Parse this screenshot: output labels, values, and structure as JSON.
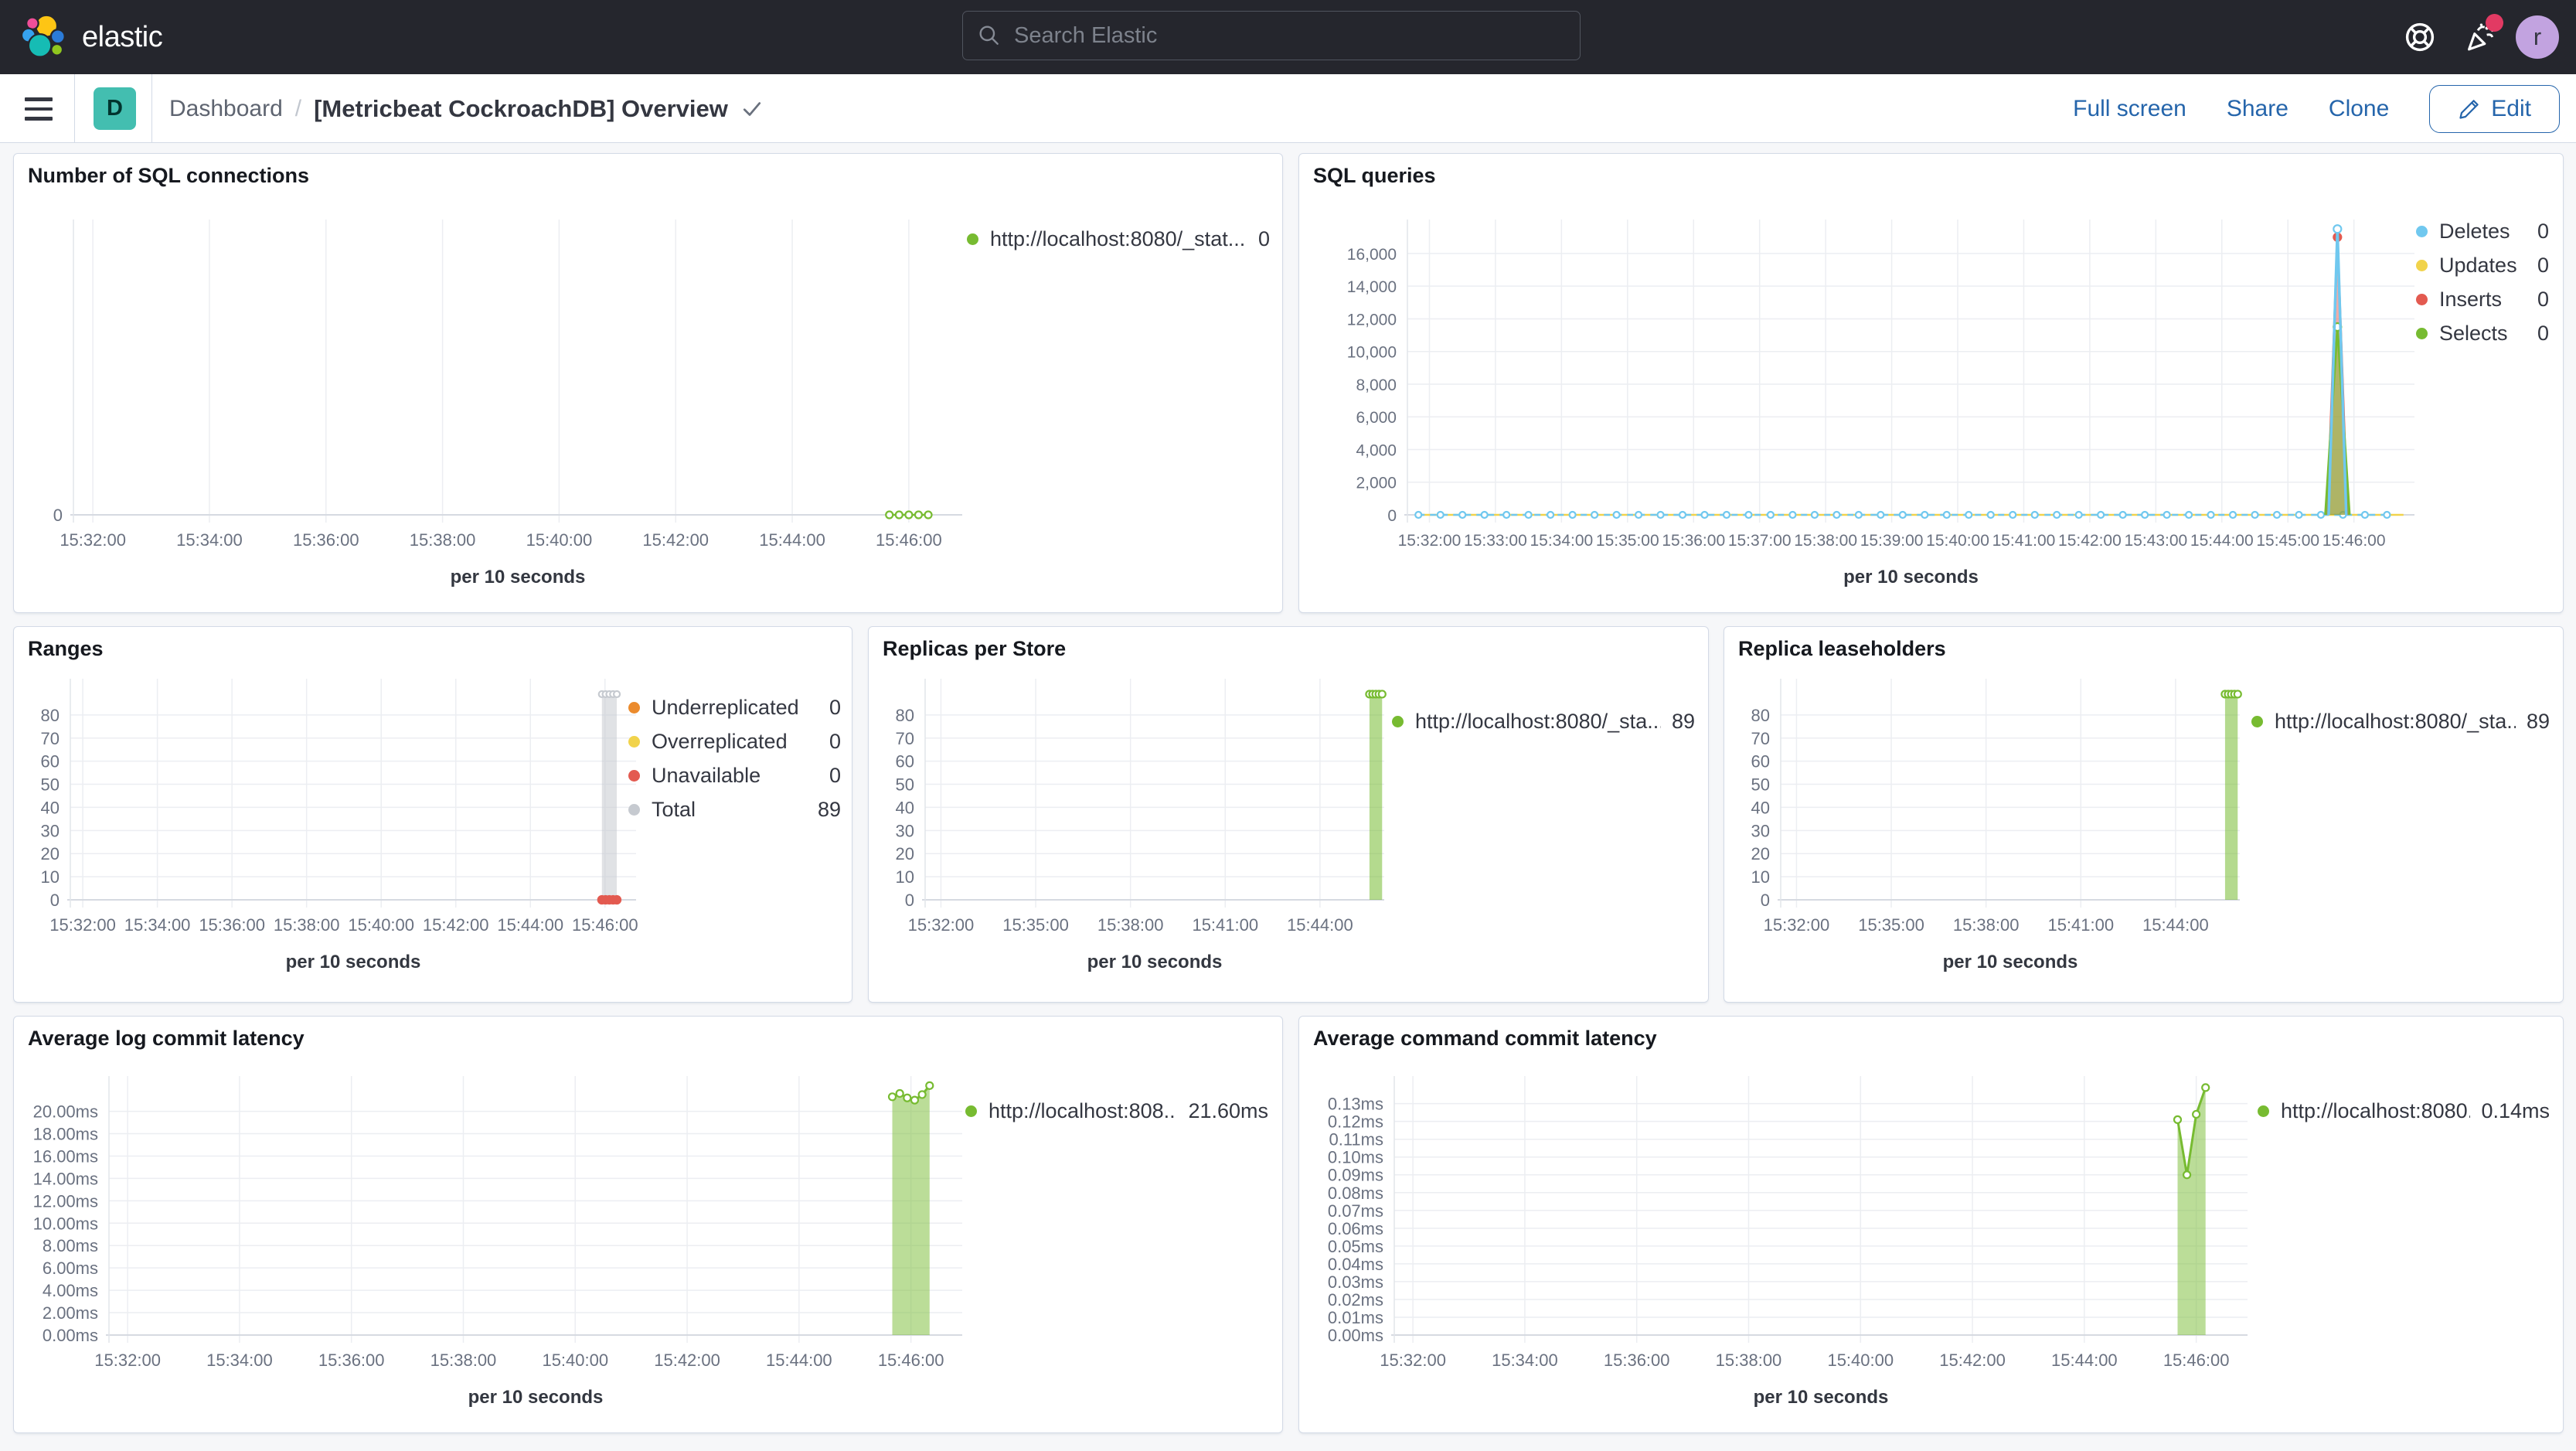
{
  "header": {
    "wordmark": "elastic",
    "search_placeholder": "Search Elastic",
    "avatar_letter": "r"
  },
  "toolbar": {
    "space_badge": "D",
    "breadcrumb": "Dashboard",
    "breadcrumb_separator": "/",
    "title": "[Metricbeat CockroachDB] Overview",
    "full_screen": "Full screen",
    "share": "Share",
    "clone": "Clone",
    "edit": "Edit"
  },
  "colors": {
    "green": "#77bb31",
    "blue": "#70c8ef",
    "yellow": "#f1d34b",
    "red": "#e35a50",
    "orange": "#eb8b2d",
    "gray": "#c6cad0",
    "link_blue": "#2565ab",
    "header_bg": "#25262d",
    "badge_pink": "#e23a63",
    "space_teal": "#43beb0"
  },
  "panels": [
    {
      "id": "sql-connections",
      "title": "Number of SQL connections",
      "legend": [
        {
          "label": "http://localhost:8080/_stat...",
          "value": "0",
          "color": "#77bb31"
        }
      ]
    },
    {
      "id": "sql-queries",
      "title": "SQL queries",
      "legend": [
        {
          "label": "Deletes",
          "value": "0",
          "color": "#70c8ef"
        },
        {
          "label": "Updates",
          "value": "0",
          "color": "#f1d34b"
        },
        {
          "label": "Inserts",
          "value": "0",
          "color": "#e35a50"
        },
        {
          "label": "Selects",
          "value": "0",
          "color": "#77bb31"
        }
      ]
    },
    {
      "id": "ranges",
      "title": "Ranges",
      "legend": [
        {
          "label": "Underreplicated",
          "value": "0",
          "color": "#eb8b2d"
        },
        {
          "label": "Overreplicated",
          "value": "0",
          "color": "#f1d34b"
        },
        {
          "label": "Unavailable",
          "value": "0",
          "color": "#e35a50"
        },
        {
          "label": "Total",
          "value": "89",
          "color": "#c6cad0"
        }
      ]
    },
    {
      "id": "replicas-per-store",
      "title": "Replicas per Store",
      "legend": [
        {
          "label": "http://localhost:8080/_sta...",
          "value": "89",
          "color": "#77bb31"
        }
      ]
    },
    {
      "id": "replica-leaseholders",
      "title": "Replica leaseholders",
      "legend": [
        {
          "label": "http://localhost:8080/_sta...",
          "value": "89",
          "color": "#77bb31"
        }
      ]
    },
    {
      "id": "avg-log-commit-latency",
      "title": "Average log commit latency",
      "legend": [
        {
          "label": "http://localhost:808...",
          "value": "21.60ms",
          "color": "#77bb31"
        }
      ]
    },
    {
      "id": "avg-command-commit-latency",
      "title": "Average command commit latency",
      "legend": [
        {
          "label": "http://localhost:8080...",
          "value": "0.14ms",
          "color": "#77bb31"
        }
      ]
    }
  ],
  "chart_data": [
    {
      "title": "Number of SQL connections",
      "type": "line",
      "x_axis_label": "per 10 seconds",
      "x_domain": [
        "15:31:40",
        "15:46:55"
      ],
      "x_ticks": [
        "15:32:00",
        "15:34:00",
        "15:36:00",
        "15:38:00",
        "15:40:00",
        "15:42:00",
        "15:44:00",
        "15:46:00"
      ],
      "y_tick_values": [
        0
      ],
      "y_tick_labels": [
        "0"
      ],
      "y_max": 10,
      "series": [
        {
          "name": "http://localhost:8080/_stat...",
          "color": "#77bb31",
          "width": 2.5,
          "markers": "all",
          "marker_style": "open",
          "marker_r": 4.5,
          "gen": {
            "from": "15:45:40",
            "to": "15:46:20",
            "step": 10,
            "value": 0
          }
        }
      ]
    },
    {
      "title": "SQL queries",
      "type": "line",
      "x_axis_label": "per 10 seconds",
      "x_domain": [
        "15:31:40",
        "15:46:55"
      ],
      "x_ticks": [
        "15:32:00",
        "15:33:00",
        "15:34:00",
        "15:35:00",
        "15:36:00",
        "15:37:00",
        "15:38:00",
        "15:39:00",
        "15:40:00",
        "15:41:00",
        "15:42:00",
        "15:43:00",
        "15:44:00",
        "15:45:00",
        "15:46:00"
      ],
      "y_tick_values": [
        0,
        2000,
        4000,
        6000,
        8000,
        10000,
        12000,
        14000,
        16000
      ],
      "y_tick_labels": [
        "0",
        "2,000",
        "4,000",
        "6,000",
        "8,000",
        "10,000",
        "12,000",
        "14,000",
        "16,000"
      ],
      "y_max": 17700,
      "series": [
        {
          "name": "Updates",
          "color": "#f1d34b",
          "width": 2.5,
          "markers": "none",
          "points": [
            [
              "15:31:50",
              0
            ],
            [
              "15:46:45",
              0
            ]
          ]
        },
        {
          "name": "Deletes",
          "color": "#70c8ef",
          "width": 2.5,
          "dash": true,
          "markers": "all",
          "marker_style": "open",
          "marker_r": 4,
          "gen": {
            "from": "15:31:50",
            "to": "15:46:40",
            "step": 20,
            "value": 0
          }
        },
        {
          "name": "Inserts",
          "color": "#e35a50",
          "width": 3,
          "fill": 0.5,
          "markers": [
            1
          ],
          "marker_style": "filled",
          "marker_r": 5,
          "points": [
            [
              "15:45:36",
              0
            ],
            [
              "15:45:45",
              17000
            ],
            [
              "15:45:54",
              0
            ]
          ]
        },
        {
          "name": "Selects",
          "color": "#77bb31",
          "width": 3,
          "fill": 0.55,
          "markers": [
            1
          ],
          "marker_style": "open",
          "marker_r": 5,
          "points": [
            [
              "15:45:34",
              0
            ],
            [
              "15:45:45",
              11500
            ],
            [
              "15:45:56",
              0
            ]
          ]
        },
        {
          "name": "Deletes",
          "color": "#70c8ef",
          "width": 3.5,
          "markers": [
            1
          ],
          "marker_style": "open",
          "marker_r": 5,
          "points": [
            [
              "15:45:37",
              0
            ],
            [
              "15:45:45",
              17500
            ],
            [
              "15:45:53",
              0
            ]
          ]
        }
      ]
    },
    {
      "title": "Ranges",
      "type": "bar",
      "x_axis_label": "per 10 seconds",
      "x_domain": [
        "15:31:40",
        "15:46:50"
      ],
      "x_ticks": [
        "15:32:00",
        "15:34:00",
        "15:36:00",
        "15:38:00",
        "15:40:00",
        "15:42:00",
        "15:44:00",
        "15:46:00"
      ],
      "y_tick_values": [
        0,
        10,
        20,
        30,
        40,
        50,
        60,
        70,
        80
      ],
      "y_tick_labels": [
        "0",
        "10",
        "20",
        "30",
        "40",
        "50",
        "60",
        "70",
        "80"
      ],
      "y_max": 93,
      "series": [
        {
          "name": "Total",
          "color": "#c6cad0",
          "width": 2,
          "fill": 0.55,
          "line": false,
          "markers": "all",
          "marker_style": "open",
          "marker_r": 4,
          "points": [
            [
              "15:45:55",
              89
            ],
            [
              "15:46:01",
              89
            ],
            [
              "15:46:07",
              89
            ],
            [
              "15:46:13",
              89
            ],
            [
              "15:46:19",
              89
            ]
          ]
        },
        {
          "name": "Unavailable",
          "color": "#e35a50",
          "line": false,
          "markers": "all",
          "marker_style": "filled",
          "marker_r": 5,
          "points": [
            [
              "15:45:55",
              0
            ],
            [
              "15:46:01",
              0
            ],
            [
              "15:46:07",
              0
            ],
            [
              "15:46:13",
              0
            ],
            [
              "15:46:19",
              0
            ]
          ]
        }
      ]
    },
    {
      "title": "Replicas per Store",
      "type": "bar",
      "x_axis_label": "per 10 seconds",
      "x_domain": [
        "15:31:30",
        "15:46:02"
      ],
      "x_ticks": [
        "15:32:00",
        "15:35:00",
        "15:38:00",
        "15:41:00",
        "15:44:00"
      ],
      "y_tick_values": [
        0,
        10,
        20,
        30,
        40,
        50,
        60,
        70,
        80
      ],
      "y_tick_labels": [
        "0",
        "10",
        "20",
        "30",
        "40",
        "50",
        "60",
        "70",
        "80"
      ],
      "y_max": 93,
      "series": [
        {
          "name": "http://localhost:8080/_sta...",
          "color": "#77bb31",
          "width": 2.5,
          "fill": 0.55,
          "markers": "all",
          "marker_style": "open",
          "marker_r": 4.5,
          "points": [
            [
              "15:45:34",
              89
            ],
            [
              "15:45:40",
              89
            ],
            [
              "15:45:46",
              89
            ],
            [
              "15:45:52",
              89
            ],
            [
              "15:45:58",
              89
            ]
          ]
        }
      ]
    },
    {
      "title": "Replica leaseholders",
      "type": "bar",
      "x_axis_label": "per 10 seconds",
      "x_domain": [
        "15:31:30",
        "15:46:02"
      ],
      "x_ticks": [
        "15:32:00",
        "15:35:00",
        "15:38:00",
        "15:41:00",
        "15:44:00"
      ],
      "y_tick_values": [
        0,
        10,
        20,
        30,
        40,
        50,
        60,
        70,
        80
      ],
      "y_tick_labels": [
        "0",
        "10",
        "20",
        "30",
        "40",
        "50",
        "60",
        "70",
        "80"
      ],
      "y_max": 93,
      "series": [
        {
          "name": "http://localhost:8080/_sta...",
          "color": "#77bb31",
          "width": 2.5,
          "fill": 0.55,
          "markers": "all",
          "marker_style": "open",
          "marker_r": 4.5,
          "points": [
            [
              "15:45:34",
              89
            ],
            [
              "15:45:40",
              89
            ],
            [
              "15:45:46",
              89
            ],
            [
              "15:45:52",
              89
            ],
            [
              "15:45:58",
              89
            ]
          ]
        }
      ]
    },
    {
      "title": "Average log commit latency",
      "type": "area",
      "x_axis_label": "per 10 seconds",
      "x_domain": [
        "15:31:40",
        "15:46:55"
      ],
      "x_ticks": [
        "15:32:00",
        "15:34:00",
        "15:36:00",
        "15:38:00",
        "15:40:00",
        "15:42:00",
        "15:44:00",
        "15:46:00"
      ],
      "y_tick_values": [
        0,
        2,
        4,
        6,
        8,
        10,
        12,
        14,
        16,
        18,
        20
      ],
      "y_tick_labels": [
        "0.00ms",
        "2.00ms",
        "4.00ms",
        "6.00ms",
        "8.00ms",
        "10.00ms",
        "12.00ms",
        "14.00ms",
        "16.00ms",
        "18.00ms",
        "20.00ms"
      ],
      "y_max": 22.6,
      "series": [
        {
          "name": "http://localhost:808...",
          "color": "#77bb31",
          "width": 3,
          "fill": 0.5,
          "markers": "all",
          "marker_style": "open",
          "marker_r": 4.5,
          "points": [
            [
              "15:45:40",
              21.3
            ],
            [
              "15:45:48",
              21.6
            ],
            [
              "15:45:56",
              21.2
            ],
            [
              "15:46:04",
              21.0
            ],
            [
              "15:46:12",
              21.5
            ],
            [
              "15:46:20",
              22.3
            ]
          ]
        }
      ]
    },
    {
      "title": "Average command commit latency",
      "type": "area",
      "x_axis_label": "per 10 seconds",
      "x_domain": [
        "15:31:40",
        "15:46:55"
      ],
      "x_ticks": [
        "15:32:00",
        "15:34:00",
        "15:36:00",
        "15:38:00",
        "15:40:00",
        "15:42:00",
        "15:44:00",
        "15:46:00"
      ],
      "y_tick_values": [
        0,
        0.01,
        0.02,
        0.03,
        0.04,
        0.05,
        0.06,
        0.07,
        0.08,
        0.09,
        0.1,
        0.11,
        0.12,
        0.13
      ],
      "y_tick_labels": [
        "0.00ms",
        "0.01ms",
        "0.02ms",
        "0.03ms",
        "0.04ms",
        "0.05ms",
        "0.06ms",
        "0.07ms",
        "0.08ms",
        "0.09ms",
        "0.10ms",
        "0.11ms",
        "0.12ms",
        "0.13ms"
      ],
      "y_max": 0.142,
      "series": [
        {
          "name": "http://localhost:8080...",
          "color": "#77bb31",
          "width": 3,
          "fill": 0.5,
          "markers": "all",
          "marker_style": "open",
          "marker_r": 4.5,
          "points": [
            [
              "15:45:40",
              0.121
            ],
            [
              "15:45:50",
              0.09
            ],
            [
              "15:46:00",
              0.124
            ],
            [
              "15:46:10",
              0.139
            ]
          ]
        }
      ]
    }
  ]
}
